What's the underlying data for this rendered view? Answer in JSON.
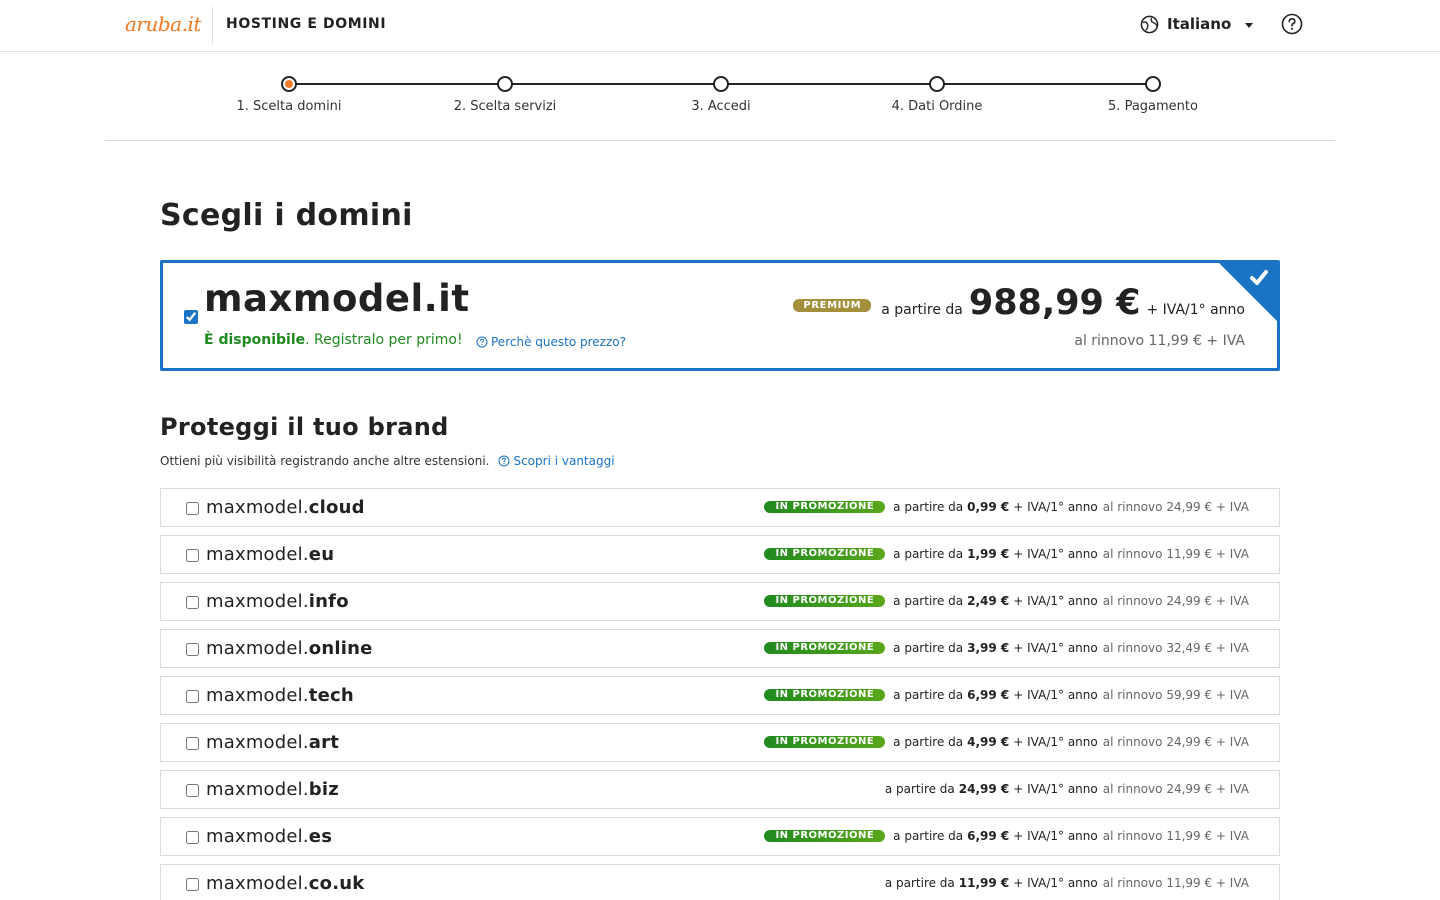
{
  "header": {
    "logo": "aruba.it",
    "title": "HOSTING E DOMINI",
    "language": "Italiano"
  },
  "stepper": {
    "steps": [
      {
        "label": "1. Scelta domini",
        "active": true
      },
      {
        "label": "2. Scelta servizi",
        "active": false
      },
      {
        "label": "3. Accedi",
        "active": false
      },
      {
        "label": "4. Dati Ordine",
        "active": false
      },
      {
        "label": "5. Pagamento",
        "active": false
      }
    ]
  },
  "main": {
    "title": "Scegli i domini",
    "selected": {
      "checked": true,
      "domain": "maxmodel.it",
      "available_bold": "È disponibile",
      "available_rest": ". Registralo per primo!",
      "why_link": "Perchè questo prezzo?",
      "badge": "PREMIUM",
      "from_label": "a partire da",
      "price": "988,99 €",
      "per": "+ IVA/1° anno",
      "renew": "al rinnovo 11,99 € + IVA"
    }
  },
  "brand": {
    "title": "Proteggi il tuo brand",
    "subtitle": "Ottieni più visibilità registrando anche altre estensioni.",
    "link": "Scopri i vantaggi",
    "from_label": "a partire da",
    "per": "+ IVA/1° anno",
    "promo_label": "IN PROMOZIONE",
    "domains": [
      {
        "base": "maxmodel.",
        "ext": "cloud",
        "promo": true,
        "price": "0,99 €",
        "renew": "al rinnovo 24,99 € + IVA"
      },
      {
        "base": "maxmodel.",
        "ext": "eu",
        "promo": true,
        "price": "1,99 €",
        "renew": "al rinnovo 11,99 € + IVA"
      },
      {
        "base": "maxmodel.",
        "ext": "info",
        "promo": true,
        "price": "2,49 €",
        "renew": "al rinnovo 24,99 € + IVA"
      },
      {
        "base": "maxmodel.",
        "ext": "online",
        "promo": true,
        "price": "3,99 €",
        "renew": "al rinnovo 32,49 € + IVA"
      },
      {
        "base": "maxmodel.",
        "ext": "tech",
        "promo": true,
        "price": "6,99 €",
        "renew": "al rinnovo 59,99 € + IVA"
      },
      {
        "base": "maxmodel.",
        "ext": "art",
        "promo": true,
        "price": "4,99 €",
        "renew": "al rinnovo 24,99 € + IVA"
      },
      {
        "base": "maxmodel.",
        "ext": "biz",
        "promo": false,
        "price": "24,99 €",
        "renew": "al rinnovo 24,99 € + IVA"
      },
      {
        "base": "maxmodel.",
        "ext": "es",
        "promo": true,
        "price": "6,99 €",
        "renew": "al rinnovo 11,99 € + IVA"
      },
      {
        "base": "maxmodel.",
        "ext": "co.uk",
        "promo": false,
        "price": "11,99 €",
        "renew": "al rinnovo 11,99 € + IVA"
      }
    ]
  },
  "colors": {
    "accent": "#1a73c5",
    "brand_orange": "#f37a20",
    "available_green": "#1f8a1f",
    "premium_gold": "#a38f3c"
  }
}
